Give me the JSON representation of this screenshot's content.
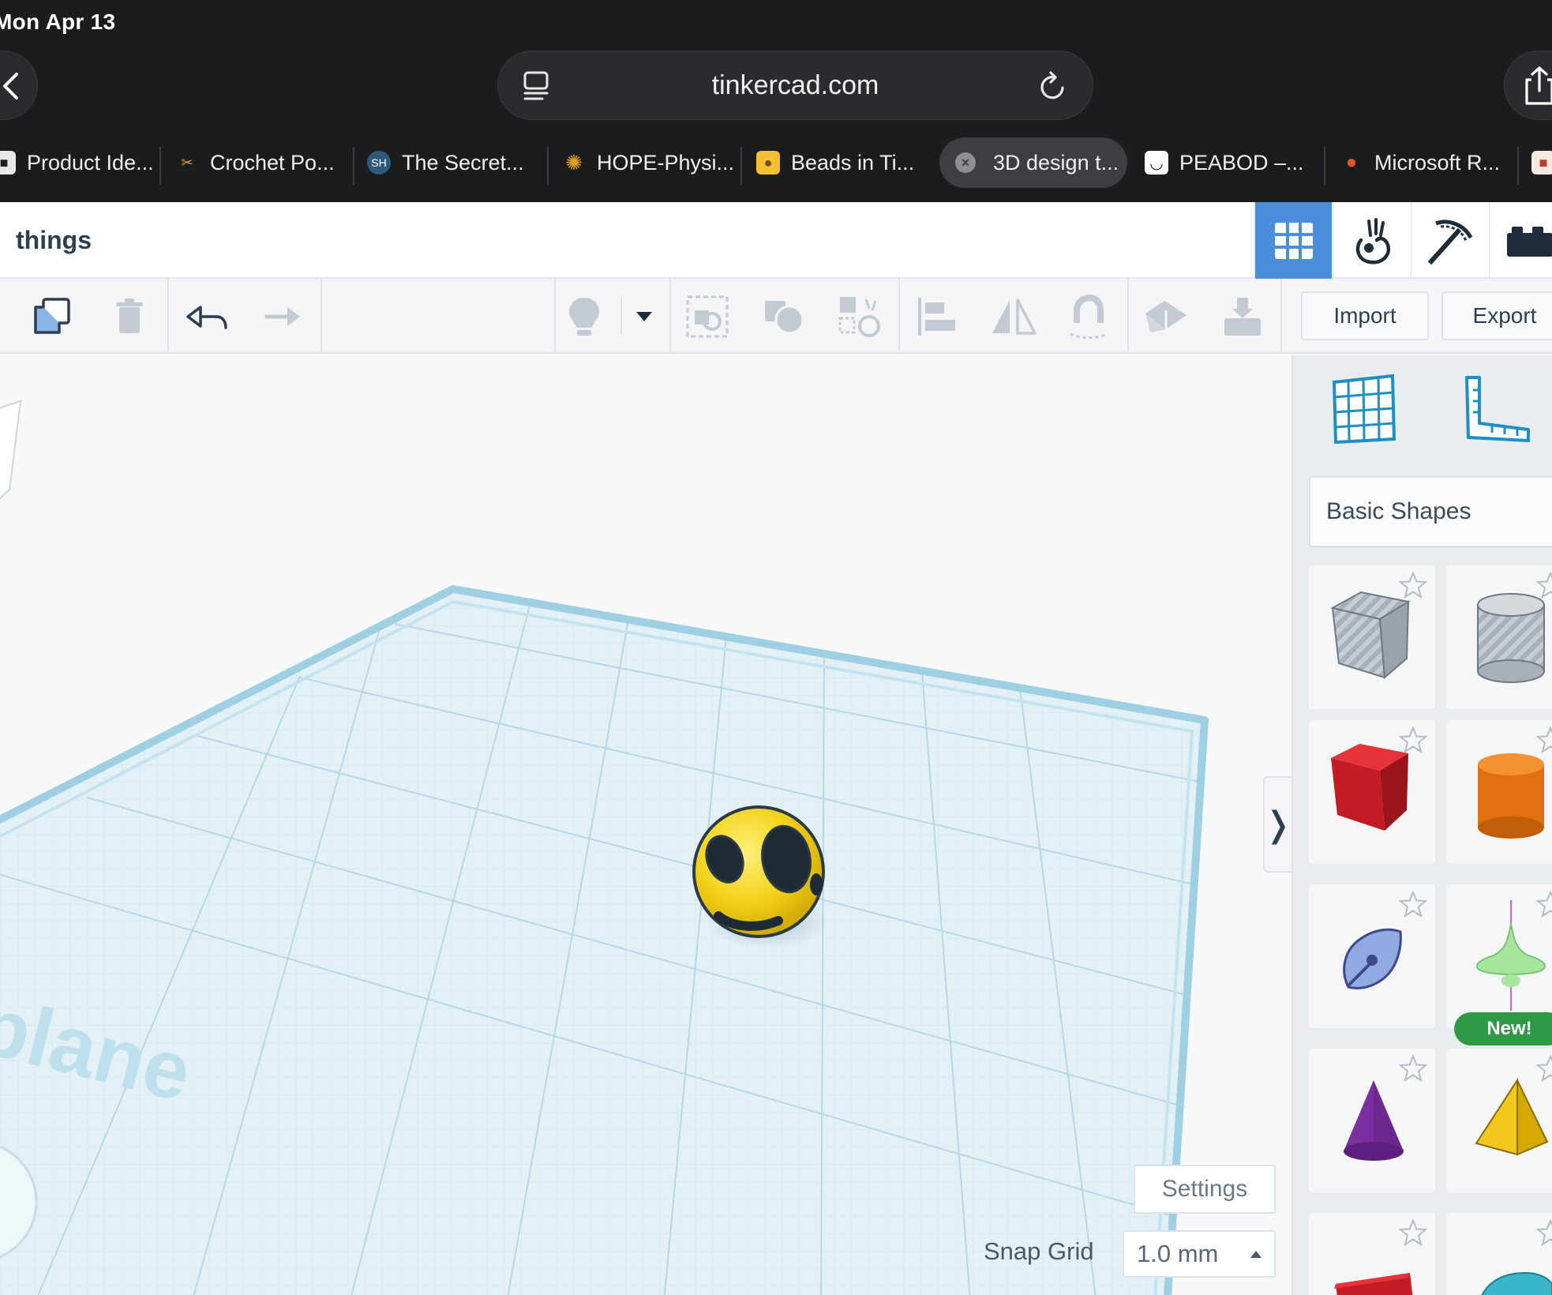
{
  "status_bar": {
    "date": "Mon Apr 13"
  },
  "browser": {
    "url": "tinkercad.com",
    "tabs": [
      {
        "label": "Product Ide...",
        "favicon_color": "#e8e8e8",
        "active": false
      },
      {
        "label": "Crochet Po...",
        "favicon_color": "#f0a040",
        "active": false
      },
      {
        "label": "The Secret...",
        "favicon_color": "#2e5a7a",
        "active": false
      },
      {
        "label": "HOPE-Physi...",
        "favicon_color": "#e0a020",
        "active": false
      },
      {
        "label": "Beads in Ti...",
        "favicon_color": "#f2c030",
        "active": false
      },
      {
        "label": "3D design t...",
        "favicon_color": "#8e8e93",
        "active": true
      },
      {
        "label": "PEABOD –...",
        "favicon_color": "#ffffff",
        "active": false
      },
      {
        "label": "Microsoft R...",
        "favicon_color": "#e0562a",
        "active": false
      }
    ]
  },
  "header": {
    "design_name": "things",
    "view_buttons": [
      "3d-design-grid-icon",
      "codeblocks-icon",
      "minecraft-pickaxe-icon",
      "brick-icon"
    ]
  },
  "toolbar": {
    "import_label": "Import",
    "export_label": "Export"
  },
  "workplane": {
    "label": "plane",
    "settings_label": "Settings",
    "snap_grid_label": "Snap Grid",
    "snap_grid_value": "1.0 mm"
  },
  "shapes_panel": {
    "category": "Basic Shapes",
    "new_badge": "New!",
    "shapes": [
      {
        "name": "box-hole",
        "color": "#b9bfc6"
      },
      {
        "name": "cylinder-hole",
        "color": "#b9bfc6"
      },
      {
        "name": "box",
        "color": "#d01f27"
      },
      {
        "name": "cylinder",
        "color": "#e57a1a"
      },
      {
        "name": "shape-generator",
        "color": "#8fa6e0"
      },
      {
        "name": "torus-shape",
        "color": "#a3e09a"
      },
      {
        "name": "cone",
        "color": "#7a2ea0"
      },
      {
        "name": "pyramid",
        "color": "#f2c81f"
      },
      {
        "name": "text",
        "color": "#d01f27"
      },
      {
        "name": "half-cylinder",
        "color": "#39b6c8"
      }
    ]
  }
}
